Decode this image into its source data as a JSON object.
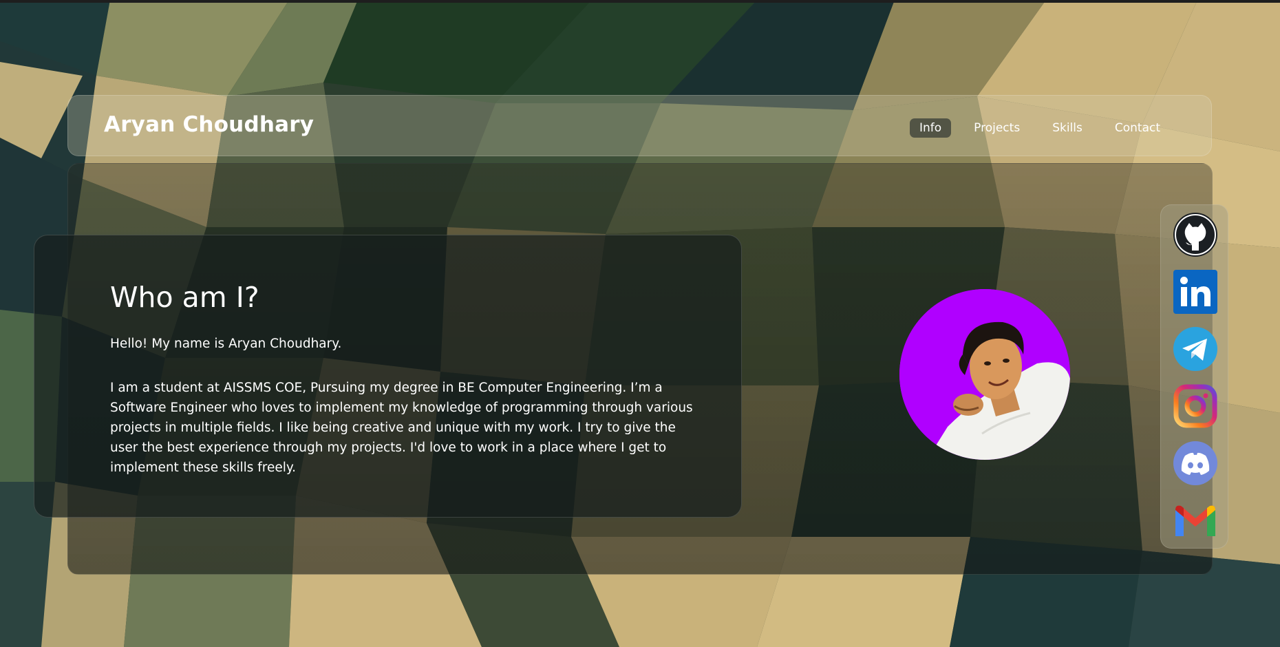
{
  "brand": {
    "name": "Aryan Choudhary"
  },
  "nav": {
    "items": [
      {
        "label": "Info",
        "active": true
      },
      {
        "label": "Projects",
        "active": false
      },
      {
        "label": "Skills",
        "active": false
      },
      {
        "label": "Contact",
        "active": false
      }
    ]
  },
  "about": {
    "title": "Who am I?",
    "intro": "Hello! My name is Aryan Choudhary.",
    "body": "I am a student at AISSMS COE, Pursuing my degree in BE Computer Engineering. I’m a Software Engineer who loves to implement my knowledge of programming through various projects in multiple fields. I like being creative and unique with my work. I try to give the user the best experience through my projects. I'd love to work in a place where I get to implement these skills freely."
  },
  "profile": {
    "photo_icon": "profile-photo",
    "photo_background": "#b000ff"
  },
  "social": [
    {
      "name": "github",
      "icon": "github-icon",
      "color": "#1b1f23"
    },
    {
      "name": "linkedin",
      "icon": "linkedin-icon",
      "color": "#0a66c2"
    },
    {
      "name": "telegram",
      "icon": "telegram-icon",
      "color": "#2aa3df"
    },
    {
      "name": "instagram",
      "icon": "instagram-icon",
      "color": "#e1306c"
    },
    {
      "name": "discord",
      "icon": "discord-icon",
      "color": "#7289da"
    },
    {
      "name": "gmail",
      "icon": "gmail-icon",
      "color": "#ea4335"
    }
  ],
  "colors": {
    "nav_active_bg": "#3a3f3a",
    "text": "#ffffff"
  }
}
